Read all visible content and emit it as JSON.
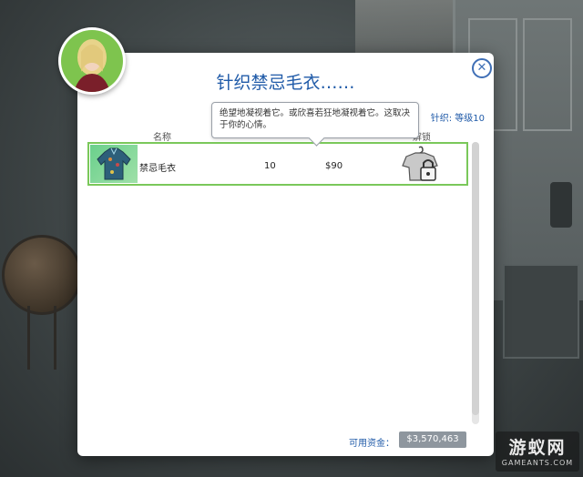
{
  "dialog": {
    "title": "针织禁忌毛衣……",
    "skill_label": "针织: 等级10",
    "close_icon": "close-icon"
  },
  "columns": {
    "name": "名称",
    "unlock": "解锁"
  },
  "tooltip": {
    "text": "绝望地凝视着它。或欣喜若狂地凝视着它。这取决于你的心情。"
  },
  "items": [
    {
      "name": "禁忌毛衣",
      "level": "10",
      "price": "$90",
      "thumbnail_icon": "sweater-icon",
      "status_icon": "locked-shirt-icon"
    }
  ],
  "funds": {
    "label": "可用资金：",
    "value": "$3,570,463"
  },
  "watermark": {
    "main": "游蚁网",
    "sub": "GAMEANTS.COM"
  },
  "colors": {
    "accent_blue": "#1f5aa8",
    "selection_green": "#7ac85a",
    "funds_box": "#8e969e"
  }
}
